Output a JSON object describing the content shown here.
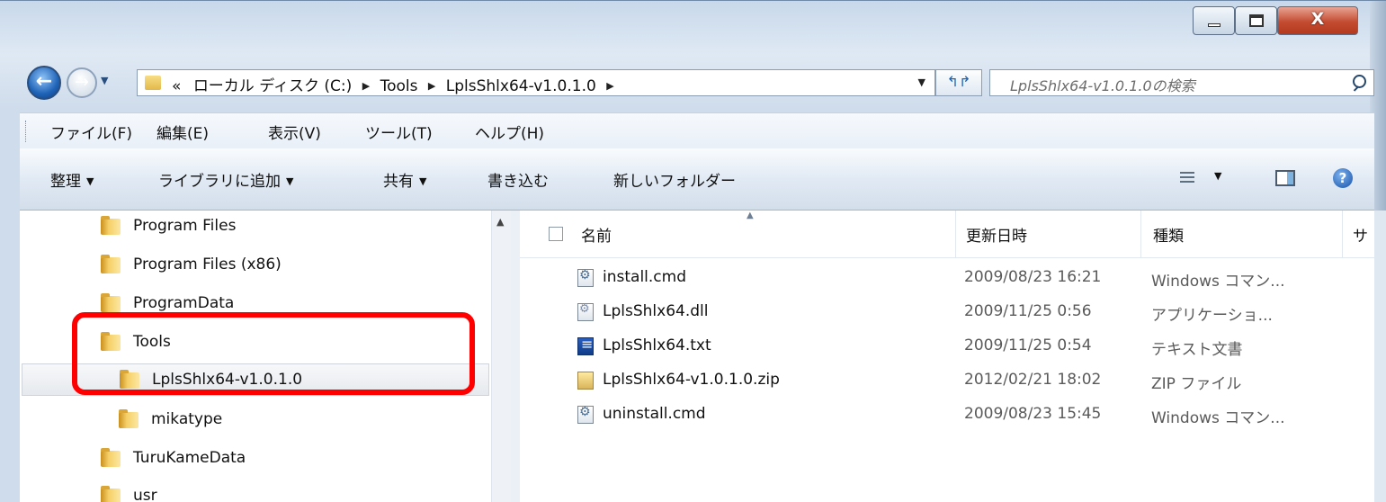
{
  "window": {
    "close_glyph": "X"
  },
  "address": {
    "overflow": "«",
    "crumbs": [
      "ローカル ディスク (C:)",
      "Tools",
      "LplsShlx64-v1.0.1.0"
    ],
    "search_placeholder": "LplsShlx64-v1.0.1.0の検索"
  },
  "menu": [
    "ファイル(F)",
    "編集(E)",
    "表示(V)",
    "ツール(T)",
    "ヘルプ(H)"
  ],
  "commands": {
    "organize": "整理",
    "add_library": "ライブラリに追加",
    "share": "共有",
    "burn": "書き込む",
    "new_folder": "新しいフォルダー"
  },
  "tree": [
    {
      "label": "Program Files",
      "level": 1
    },
    {
      "label": "Program Files (x86)",
      "level": 1
    },
    {
      "label": "ProgramData",
      "level": 1
    },
    {
      "label": "Tools",
      "level": 1
    },
    {
      "label": "LplsShlx64-v1.0.1.0",
      "level": 2,
      "selected": true
    },
    {
      "label": "mikatype",
      "level": 2
    },
    {
      "label": "TuruKameData",
      "level": 1
    },
    {
      "label": "usr",
      "level": 1
    }
  ],
  "columns": {
    "name": "名前",
    "date": "更新日時",
    "type": "種類",
    "size": "サ"
  },
  "files": [
    {
      "name": "install.cmd",
      "date": "2009/08/23 16:21",
      "type": "Windows コマン...",
      "icon": "cmd"
    },
    {
      "name": "LplsShlx64.dll",
      "date": "2009/11/25 0:56",
      "type": "アプリケーショ...",
      "icon": "dll"
    },
    {
      "name": "LplsShlx64.txt",
      "date": "2009/11/25 0:54",
      "type": "テキスト文書",
      "icon": "txt"
    },
    {
      "name": "LplsShlx64-v1.0.1.0.zip",
      "date": "2012/02/21 18:02",
      "type": "ZIP ファイル",
      "icon": "zip"
    },
    {
      "name": "uninstall.cmd",
      "date": "2009/08/23 15:45",
      "type": "Windows コマン...",
      "icon": "cmd"
    }
  ],
  "colors": {
    "highlight": "#ff0000",
    "accent": "#1f63b7"
  }
}
